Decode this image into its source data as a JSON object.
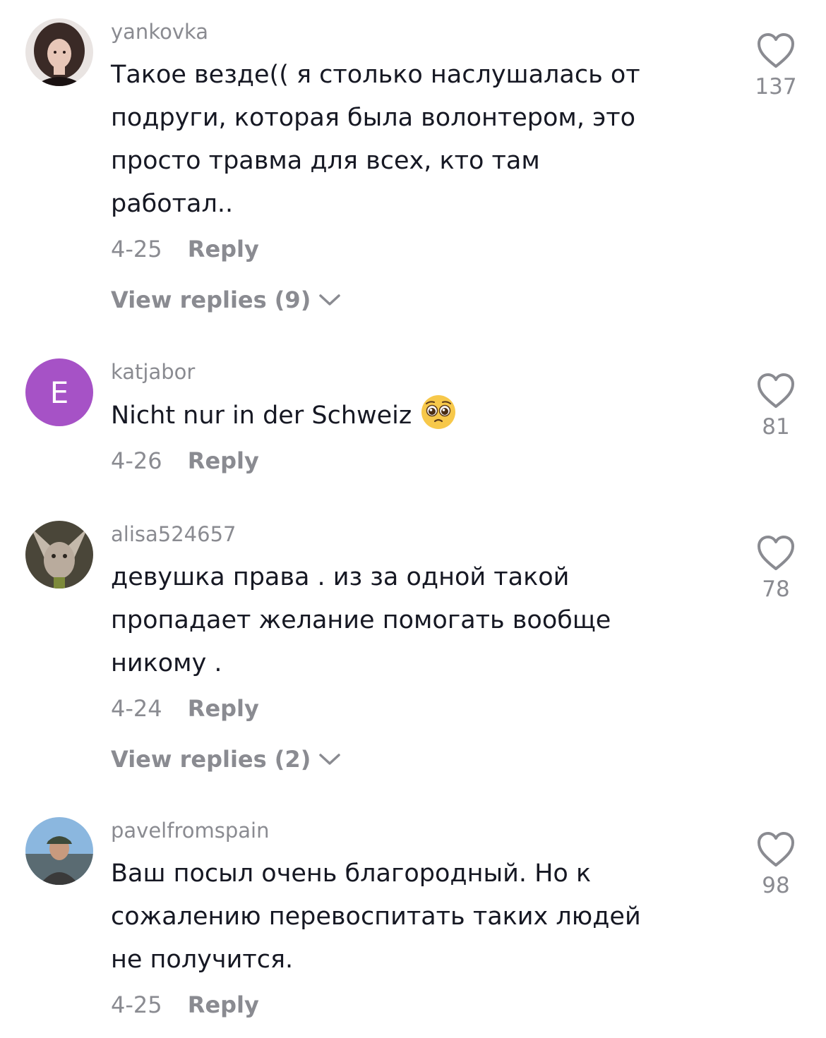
{
  "comments": [
    {
      "username": "yankovka",
      "avatar": "photo-curly-hair-avatar",
      "text": "Такое везде(( я столько наслушалась от\nподруги, которая была волонтером, это\nпросто травма для всех, кто там\nработал..",
      "date": "4-25",
      "reply_label": "Reply",
      "view_replies": "View replies (9)",
      "likes": "137"
    },
    {
      "username": "katjabor",
      "avatar": "letter-avatar",
      "avatar_letter": "E",
      "avatar_color": "#a652c6",
      "text": "Nicht nur in der Schweiz",
      "emoji": "pleading-face-emoji",
      "date": "4-26",
      "reply_label": "Reply",
      "likes": "81"
    },
    {
      "username": "alisa524657",
      "avatar": "photo-cat-avatar",
      "text": "девушка права . из за одной такой\nпропадает желание помогать вообще\nникому .",
      "date": "4-24",
      "reply_label": "Reply",
      "view_replies": "View replies (2)",
      "likes": "78"
    },
    {
      "username": "pavelfromspain",
      "avatar": "photo-man-cap-avatar",
      "text": "Ваш посыл очень благородный. Но к\nсожалению перевоспитать таких людей\nне получится.",
      "date": "4-25",
      "reply_label": "Reply",
      "likes": "98"
    }
  ],
  "colors": {
    "secondary_text": "#8a8b91",
    "primary_text": "#161823",
    "like_icon": "#8a8b91"
  }
}
